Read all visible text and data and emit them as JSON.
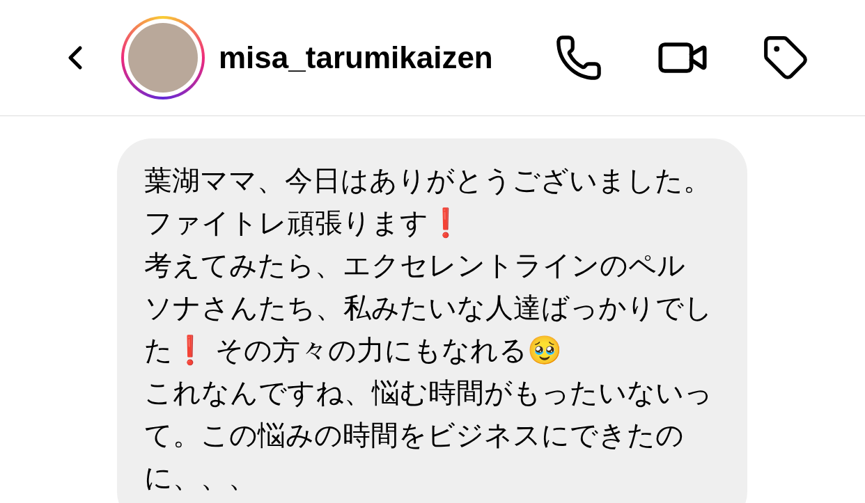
{
  "header": {
    "username": "misa_tarumikaizen",
    "has_story": true
  },
  "messages": [
    {
      "text": "葉湖ママ、今日はありがとうございました。ファイトレ頑張ります❗\n考えてみたら、エクセレントラインのペルソナさんたち、私みたいな人達ばっかりでした❗ その方々の力にもなれる🥹\nこれなんですね、悩む時間がもったいないって。この悩みの時間をビジネスにできたのに、、、"
    }
  ]
}
